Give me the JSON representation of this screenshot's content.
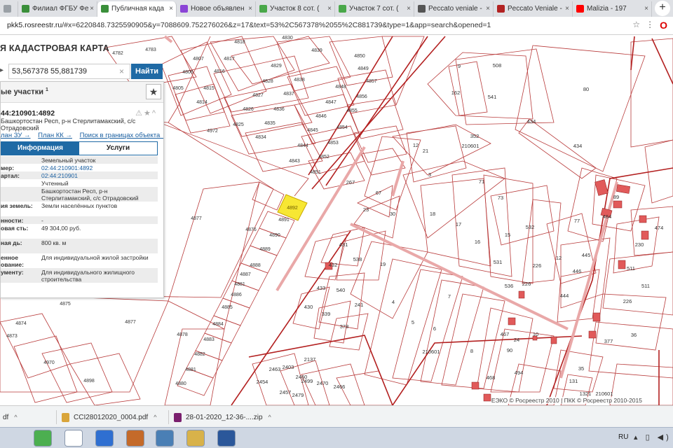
{
  "browser": {
    "tabs": [
      {
        "label": "",
        "icon": "blank-tab",
        "color": "#9aa0a6"
      },
      {
        "label": "Филиал ФГБУ Фе",
        "icon": "globe-icon",
        "color": "#3a8f3a"
      },
      {
        "label": "Публичная када",
        "icon": "map-icon",
        "color": "#3a8f3a",
        "active": true
      },
      {
        "label": "Новое объявлен",
        "icon": "avito-icon",
        "color": "#8b44d6"
      },
      {
        "label": "Участок 8 сот. (",
        "icon": "avito-icon",
        "color": "#4aa84a"
      },
      {
        "label": "Участок 7 сот. (",
        "icon": "avito-icon",
        "color": "#4aa84a"
      },
      {
        "label": "Peccato veniale -",
        "icon": "music-icon",
        "color": "#555555"
      },
      {
        "label": "Peccato Veniale -",
        "icon": "music-icon",
        "color": "#b22222"
      },
      {
        "label": "Malizia - 197",
        "icon": "youtube-icon",
        "color": "#ff0000"
      }
    ],
    "new_tab": "+",
    "url_domain": "pkk5.rosreestr.ru",
    "url_rest": "/#x=6220848.7325590905&y=7088609.752276026&z=17&text=53%2C567378%2055%2C881739&type=1&app=search&opened=1"
  },
  "map": {
    "title": "Я КАДАСТРОВАЯ КАРТА",
    "search_value": "53,567378 55,881739",
    "search_button": "Найти",
    "attribution": "ЕЭКО © Росреестр 2010 | ПКК © Росреестр 2010-2015",
    "highlight_parcel": "4892",
    "labels": [
      [
        "4782",
        168,
        78
      ],
      [
        "4783",
        215,
        73
      ],
      [
        "4806",
        268,
        105
      ],
      [
        "4807",
        283,
        86
      ],
      [
        "4818",
        342,
        62
      ],
      [
        "4830",
        410,
        56
      ],
      [
        "4839",
        452,
        74
      ],
      [
        "4850",
        513,
        82
      ],
      [
        "4817",
        327,
        86
      ],
      [
        "4816",
        313,
        104
      ],
      [
        "4815",
        298,
        128
      ],
      [
        "4814",
        288,
        148
      ],
      [
        "4829",
        394,
        96
      ],
      [
        "4828",
        382,
        118
      ],
      [
        "4827",
        368,
        138
      ],
      [
        "4826",
        354,
        158
      ],
      [
        "4825",
        340,
        180
      ],
      [
        "4838",
        427,
        116
      ],
      [
        "4837",
        412,
        136
      ],
      [
        "4836",
        398,
        158
      ],
      [
        "4835",
        385,
        178
      ],
      [
        "4834",
        372,
        198
      ],
      [
        "4849",
        518,
        100
      ],
      [
        "4848",
        486,
        126
      ],
      [
        "4847",
        472,
        148
      ],
      [
        "4846",
        458,
        168
      ],
      [
        "4845",
        446,
        188
      ],
      [
        "4844",
        432,
        210
      ],
      [
        "4843",
        420,
        232
      ],
      [
        "4857",
        530,
        118
      ],
      [
        "4856",
        516,
        140
      ],
      [
        "4855",
        502,
        160
      ],
      [
        "4854",
        488,
        184
      ],
      [
        "4853",
        475,
        206
      ],
      [
        "4852",
        462,
        226
      ],
      [
        "4851",
        450,
        248
      ],
      [
        "4805",
        254,
        128
      ],
      [
        "4972",
        303,
        189
      ],
      [
        "4877",
        280,
        314
      ],
      [
        "4876",
        358,
        330
      ],
      [
        "4875",
        93,
        436
      ],
      [
        "4877",
        186,
        462
      ],
      [
        "4874",
        30,
        464
      ],
      [
        "4873",
        17,
        482
      ],
      [
        "4970",
        70,
        520
      ],
      [
        "4898",
        127,
        546
      ],
      [
        "4891",
        405,
        316
      ],
      [
        "4890",
        392,
        338
      ],
      [
        "4889",
        378,
        358
      ],
      [
        "4888",
        364,
        381
      ],
      [
        "4887",
        350,
        394
      ],
      [
        "4886",
        337,
        423
      ],
      [
        "4885",
        324,
        441
      ],
      [
        "4884",
        311,
        465
      ],
      [
        "4883",
        298,
        487
      ],
      [
        "4882",
        285,
        508
      ],
      [
        "4881",
        272,
        530
      ],
      [
        "4880",
        258,
        550
      ],
      [
        "4878",
        260,
        480
      ],
      [
        "4881",
        342,
        408
      ],
      [
        "2137",
        442,
        516
      ],
      [
        "267",
        500,
        263
      ],
      [
        "12",
        593,
        210
      ],
      [
        "21",
        607,
        218
      ],
      [
        "3",
        613,
        252
      ],
      [
        "18",
        617,
        308
      ],
      [
        "17",
        654,
        323
      ],
      [
        "16",
        681,
        348
      ],
      [
        "15",
        724,
        338
      ],
      [
        "73",
        714,
        285
      ],
      [
        "71",
        687,
        262
      ],
      [
        "508",
        709,
        96
      ],
      [
        "541",
        702,
        141
      ],
      [
        "80",
        836,
        130
      ],
      [
        "434",
        758,
        176
      ],
      [
        "434",
        824,
        211
      ],
      [
        "352",
        677,
        197
      ],
      [
        "210601",
        671,
        211
      ],
      [
        "9",
        655,
        97
      ],
      [
        "162",
        650,
        135
      ],
      [
        "67",
        540,
        278
      ],
      [
        "30",
        560,
        308
      ],
      [
        "23",
        522,
        302
      ],
      [
        "431",
        490,
        352
      ],
      [
        "432",
        475,
        381
      ],
      [
        "538",
        510,
        373
      ],
      [
        "19",
        546,
        380
      ],
      [
        "540",
        486,
        417
      ],
      [
        "433",
        458,
        414
      ],
      [
        "241",
        512,
        438
      ],
      [
        "430",
        440,
        441
      ],
      [
        "339",
        465,
        451
      ],
      [
        "378",
        491,
        469
      ],
      [
        "4",
        561,
        434
      ],
      [
        "5",
        589,
        463
      ],
      [
        "6",
        620,
        472
      ],
      [
        "8",
        673,
        504
      ],
      [
        "7",
        641,
        426
      ],
      [
        "531",
        710,
        377
      ],
      [
        "532",
        756,
        327
      ],
      [
        "226",
        766,
        382
      ],
      [
        "12",
        797,
        371
      ],
      [
        "446",
        823,
        390
      ],
      [
        "445",
        836,
        367
      ],
      [
        "444",
        805,
        425
      ],
      [
        "536",
        726,
        411
      ],
      [
        "226",
        751,
        408
      ],
      [
        "467",
        720,
        480
      ],
      [
        "24",
        737,
        488
      ],
      [
        "10",
        764,
        480
      ],
      [
        "90",
        727,
        503
      ],
      [
        "494",
        740,
        535
      ],
      [
        "468",
        700,
        542
      ],
      [
        "35",
        829,
        529
      ],
      [
        "131",
        818,
        547
      ],
      [
        "210601",
        615,
        505
      ],
      [
        "77",
        823,
        318
      ],
      [
        "89",
        879,
        284
      ],
      [
        "464",
        866,
        312
      ],
      [
        "474",
        940,
        328
      ],
      [
        "230",
        912,
        352
      ],
      [
        "511",
        900,
        386
      ],
      [
        "511",
        921,
        411
      ],
      [
        "226",
        895,
        433
      ],
      [
        "36",
        904,
        481
      ],
      [
        "377",
        868,
        490
      ],
      [
        "1321",
        835,
        565
      ],
      [
        "210601",
        862,
        565
      ],
      [
        "2499",
        438,
        547
      ],
      [
        "2470",
        460,
        550
      ],
      [
        "2466",
        484,
        555
      ],
      [
        "2454",
        374,
        548
      ],
      [
        "2463",
        392,
        530
      ],
      [
        "2403",
        411,
        527
      ],
      [
        "2457",
        407,
        563
      ],
      [
        "2479",
        425,
        567
      ],
      [
        "2460",
        430,
        541
      ]
    ]
  },
  "panel": {
    "title": "ые участки",
    "title_sup": "1",
    "parcel_id": "44:210901:4892",
    "address": "Башкортостан Респ, р-н Стерлитамакский, с/с Отрадовский",
    "links": [
      "лан ЗУ →",
      "План КК →",
      "Поиск в границах объекта →"
    ],
    "tab_info": "Информация",
    "tab_services": "Услуги",
    "attributes": [
      {
        "label": "",
        "value": "Земельный участок",
        "link": false
      },
      {
        "label": "мер:",
        "value": "02:44:210901:4892",
        "link": true
      },
      {
        "label": "артал:",
        "value": "02:44:210901",
        "link": true
      },
      {
        "label": "",
        "value": "Учтенный",
        "link": false
      },
      {
        "label": "",
        "value": "Башкортостан Респ, р-н Стерлитамакский, с/с Отрадовский",
        "link": false
      },
      {
        "label": "ия земель:",
        "value": "Земли населённых пунктов",
        "link": false
      },
      {
        "label": "нности:",
        "value": "-",
        "link": false
      },
      {
        "label": "овая сть:",
        "value": "49 304,00 руб.",
        "link": false
      },
      {
        "label": "ная дь:",
        "value": "800 кв. м",
        "link": false
      },
      {
        "label": "енное ование:",
        "value": "Для индивидуальной жилой застройки",
        "link": false
      },
      {
        "label": "ументу:",
        "value": "Для индивидуального жилищного строительства",
        "link": false
      }
    ]
  },
  "downloads": [
    {
      "label": "df",
      "icon": "pdf-icon",
      "color": "#888888"
    },
    {
      "label": "CCI28012020_0004.pdf",
      "icon": "pdf-icon",
      "color": "#d9a53a"
    },
    {
      "label": "28-01-2020_12-36-....zip",
      "icon": "zip-icon",
      "color": "#7a1f6e"
    }
  ],
  "taskbar": {
    "lang": "RU",
    "icons": [
      {
        "name": "chrome-icon",
        "color": "#4caf50"
      },
      {
        "name": "yandex-icon",
        "color": "#ffffff"
      },
      {
        "name": "browser-icon",
        "color": "#2f6fd1"
      },
      {
        "name": "notes-icon",
        "color": "#c46a2a"
      },
      {
        "name": "photo-viewer-icon",
        "color": "#4a7fb5"
      },
      {
        "name": "folder-icon",
        "color": "#d8b24a"
      },
      {
        "name": "word-icon",
        "color": "#2b579a"
      }
    ]
  }
}
